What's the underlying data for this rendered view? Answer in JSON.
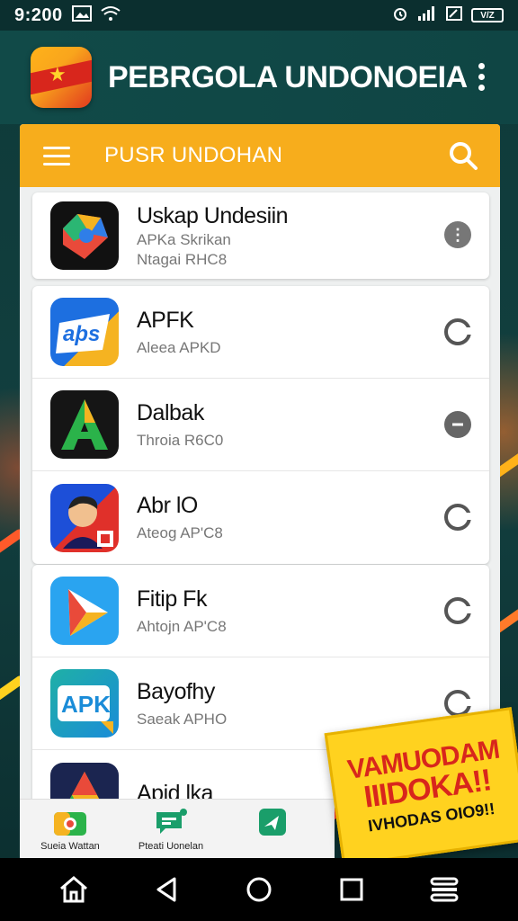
{
  "status_bar": {
    "time": "9:200",
    "battery": "V/Z"
  },
  "header": {
    "title": "PEBRGOLA UNDONOEIA"
  },
  "search_bar": {
    "title": "PUSR UNDOHAN"
  },
  "apps": [
    {
      "name": "Uskap Undesiin",
      "sub": "APKa Skrikan",
      "sub2": "Ntagai RHC8",
      "action": "info"
    },
    {
      "name": "APFK",
      "sub": "Aleea APKD",
      "action": "download"
    },
    {
      "name": "Dalbak",
      "sub": "Throia R6C0",
      "action": "installed"
    },
    {
      "name": "Abr lO",
      "sub": "Ateog AP'C8",
      "action": "download"
    },
    {
      "name": "Fitip Fk",
      "sub": "Ahtojn AP'C8",
      "action": "download"
    },
    {
      "name": "Bayofhy",
      "sub": "Saeak APHO",
      "action": "download"
    },
    {
      "name": "Apjd lka",
      "sub": "",
      "action": "download"
    }
  ],
  "promo": {
    "line1": "VAMUODAM",
    "line2": "IIIDOKA!!",
    "line3": "IVHODAS OIO9!!"
  },
  "tabs": [
    {
      "label": "Sueia Wattan",
      "icon": "camera-icon"
    },
    {
      "label": "Pteati Uonelan",
      "icon": "chat-icon"
    },
    {
      "label": "",
      "icon": "send-icon"
    }
  ],
  "colors": {
    "accent": "#f7ad1c",
    "header": "#114a48",
    "promo": "#ffd21f"
  }
}
